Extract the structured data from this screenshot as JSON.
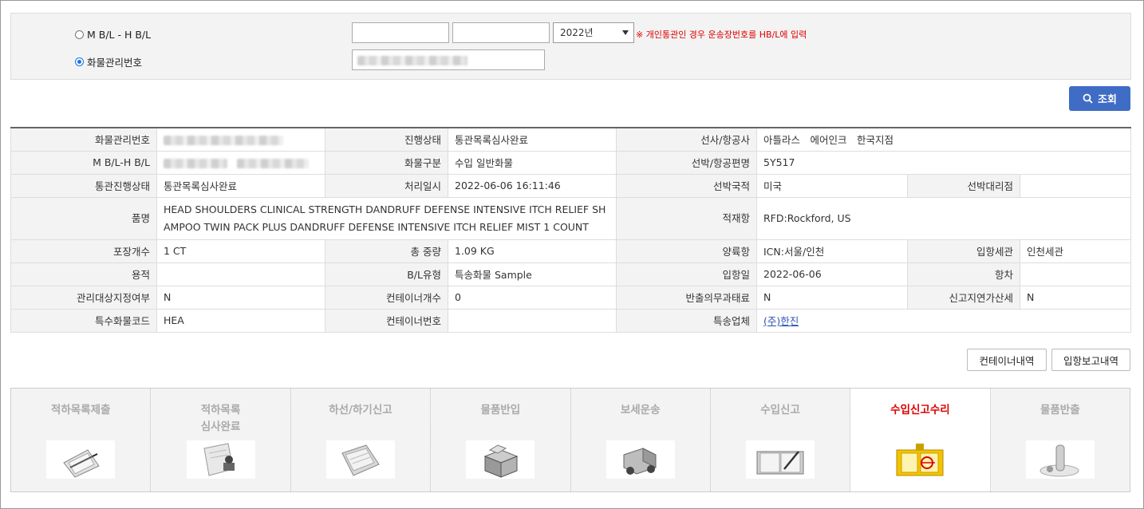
{
  "search": {
    "radio_mbl_label": "M B/L - H B/L",
    "radio_cargo_label": "화물관리번호",
    "year_value": "2022년",
    "warning": "※ 개인통관인 경우 운송장번호를 HB/L에 입력",
    "search_button": "조회"
  },
  "info": {
    "rows": [
      [
        {
          "h": "화물관리번호",
          "v": ""
        },
        {
          "h": "진행상태",
          "v": "통관목록심사완료"
        },
        {
          "h": "선사/항공사",
          "v": "아틀라스　에어인크　한국지점"
        }
      ],
      [
        {
          "h": "M B/L-H B/L",
          "v": ""
        },
        {
          "h": "화물구분",
          "v": "수입 일반화물"
        },
        {
          "h": "선박/항공편명",
          "v": "5Y517"
        }
      ],
      [
        {
          "h": "통관진행상태",
          "v": "통관목록심사완료"
        },
        {
          "h": "처리일시",
          "v": "2022-06-06 16:11:46"
        },
        {
          "h": "선박국적",
          "v": "미국"
        },
        {
          "h": "선박대리점",
          "v": ""
        }
      ],
      [
        {
          "h": "품명",
          "v": "HEAD SHOULDERS CLINICAL STRENGTH DANDRUFF DEFENSE INTENSIVE ITCH RELIEF SHAMPOO TWIN PACK PLUS DANDRUFF DEFENSE INTENSIVE ITCH RELIEF MIST 1 COUNT"
        },
        {
          "h": "적재항",
          "v": "RFD:Rockford, US"
        }
      ],
      [
        {
          "h": "포장개수",
          "v": "1 CT"
        },
        {
          "h": "총 중량",
          "v": "1.09 KG"
        },
        {
          "h": "양륙항",
          "v": "ICN:서울/인천"
        },
        {
          "h": "입항세관",
          "v": "인천세관"
        }
      ],
      [
        {
          "h": "용적",
          "v": ""
        },
        {
          "h": "B/L유형",
          "v": "특송화물 Sample"
        },
        {
          "h": "입항일",
          "v": "2022-06-06"
        },
        {
          "h": "항차",
          "v": ""
        }
      ],
      [
        {
          "h": "관리대상지정여부",
          "v": "N"
        },
        {
          "h": "컨테이너개수",
          "v": "0"
        },
        {
          "h": "반출의무과태료",
          "v": "N"
        },
        {
          "h": "신고지연가산세",
          "v": "N"
        }
      ],
      [
        {
          "h": "특수화물코드",
          "v": "HEA"
        },
        {
          "h": "컨테이너번호",
          "v": ""
        },
        {
          "h": "특송업체",
          "v": "(주)한진"
        }
      ]
    ]
  },
  "buttons": {
    "container": "컨테이너내역",
    "arrival": "입항보고내역"
  },
  "steps": [
    {
      "label": "적하목록제출",
      "icon": "clipboard-icon"
    },
    {
      "label": "적하목록\n심사완료",
      "icon": "stamp-icon"
    },
    {
      "label": "하선/하기신고",
      "icon": "folder-icon"
    },
    {
      "label": "물품반입",
      "icon": "box-icon"
    },
    {
      "label": "보세운송",
      "icon": "truck-icon"
    },
    {
      "label": "수입신고",
      "icon": "notebook-icon"
    },
    {
      "label": "수입신고수리",
      "icon": "approval-icon",
      "active": true
    },
    {
      "label": "물품반출",
      "icon": "release-icon"
    }
  ]
}
